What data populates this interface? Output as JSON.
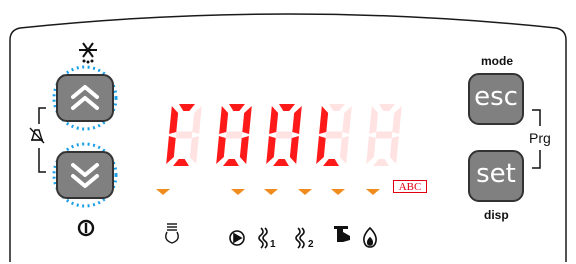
{
  "display": {
    "text": "COOL",
    "unit_badge": "ABC",
    "segment_color": "#ff1a1a",
    "dim_segment_color": "#ffe3e3"
  },
  "buttons": {
    "esc": {
      "label": "esc",
      "caption": "mode"
    },
    "set": {
      "label": "set",
      "caption": "disp"
    },
    "group_label": "Prg",
    "up": {
      "icon": "chevron-double-up-icon"
    },
    "down": {
      "icon": "chevron-double-down-icon"
    }
  },
  "status_icons": [
    {
      "name": "defrost-drip-icon"
    },
    {
      "name": "compressor-icon"
    },
    {
      "name": "fan-1-icon",
      "index": "1"
    },
    {
      "name": "fan-2-icon",
      "index": "2"
    },
    {
      "name": "light-icon"
    },
    {
      "name": "fire-icon"
    }
  ],
  "top_icons": {
    "up": "snowflake-icon",
    "side": "alarm-mute-icon",
    "down": "power-icon"
  },
  "colors": {
    "accent_orange": "#f08c1e",
    "button_gray": "#808080",
    "highlight_dots": "#1aa0e8"
  }
}
